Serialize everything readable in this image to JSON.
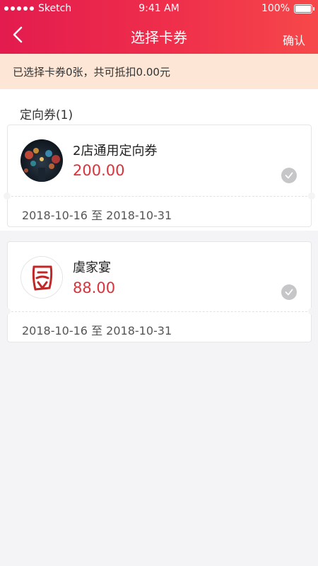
{
  "status_bar": {
    "carrier": "Sketch",
    "time": "9:41 AM",
    "battery": "100%"
  },
  "nav": {
    "title": "选择卡券",
    "confirm_label": "确认",
    "back_icon": "chevron-left-icon"
  },
  "notice": {
    "text": "已选择卡券0张，共可抵扣0.00元"
  },
  "section": {
    "title": "定向券(1)"
  },
  "coupons": [
    {
      "name": "2店通用定向券",
      "price": "200.00",
      "date_range": "2018-10-16 至 2018-10-31",
      "image": "city-night-lights-image",
      "selected": false
    },
    {
      "name": "虞家宴",
      "price": "88.00",
      "date_range": "2018-10-16 至 2018-10-31",
      "image": "red-seal-logo",
      "selected": false
    }
  ],
  "colors": {
    "header_gradient_start": "#e31b4e",
    "header_gradient_end": "#f6484a",
    "price": "#d9333b",
    "notice_bg": "#fde6d5",
    "check_gray": "#c6c6c8"
  }
}
